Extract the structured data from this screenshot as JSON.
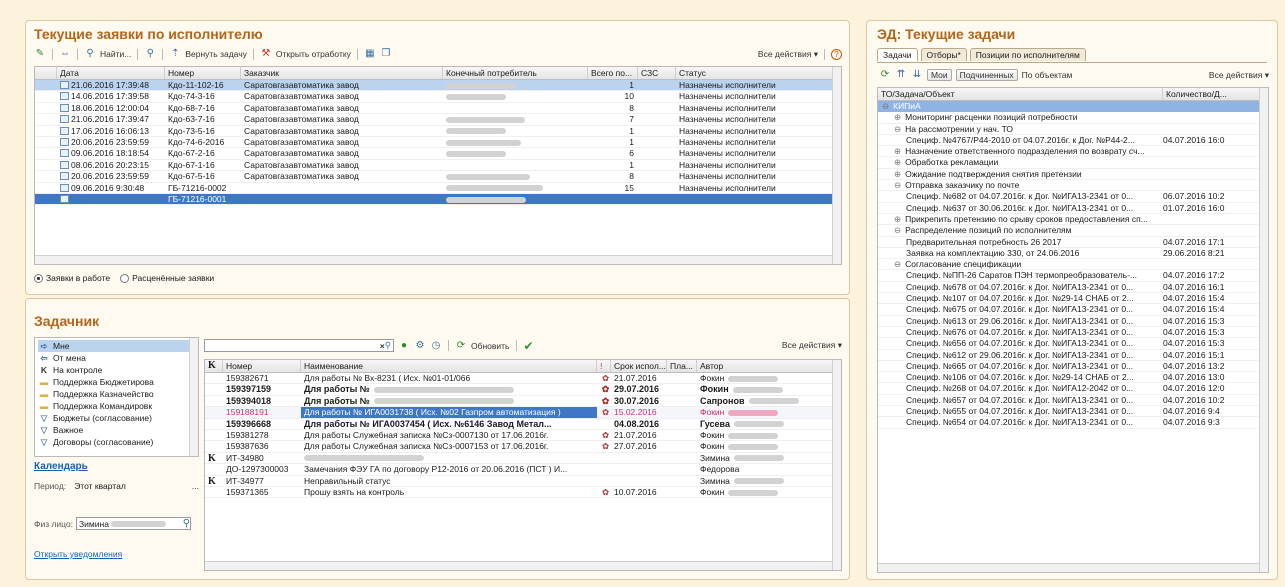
{
  "left_top": {
    "title": "Текущие заявки по исполнителю",
    "toolbar": [
      "Найти...",
      "Вернуть задачу",
      "Открыть отработку"
    ],
    "all_actions": "Все действия ▾",
    "columns": [
      "Дата",
      "Номер",
      "Заказчик",
      "Конечный потребитель",
      "Всего по...",
      "СЗС",
      "Статус"
    ],
    "rows": [
      {
        "date": "21.06.2016 17:39:48",
        "num": "Кдо-11-102-16",
        "cust": "Саратовгазавтоматика завод",
        "total": "1",
        "status": "Назначены исполнители"
      },
      {
        "date": "14.06.2016 17:39:58",
        "num": "Кдо-74-3-16",
        "cust": "Саратовгазавтоматика завод",
        "total": "10",
        "status": "Назначены исполнители"
      },
      {
        "date": "18.06.2016 12:00:04",
        "num": "Кдо-68-7-16",
        "cust": "Саратовгазавтоматика завод",
        "total": "8",
        "status": "Назначены исполнители"
      },
      {
        "date": "21.06.2016 17:39:47",
        "num": "Кдо-63-7-16",
        "cust": "Саратовгазавтоматика завод",
        "total": "7",
        "status": "Назначены исполнители"
      },
      {
        "date": "17.06.2016 16:06:13",
        "num": "Кдо-73-5-16",
        "cust": "Саратовгазавтоматика завод",
        "total": "1",
        "status": "Назначены исполнители"
      },
      {
        "date": "20.06.2016 23:59:59",
        "num": "Кдо-74-6-2016",
        "cust": "Саратовгазавтоматика завод",
        "total": "1",
        "status": "Назначены исполнители"
      },
      {
        "date": "09.06.2016 18:18:54",
        "num": "Кдо-67-2-16",
        "cust": "Саратовгазавтоматика завод",
        "total": "6",
        "status": "Назначены исполнители"
      },
      {
        "date": "08.06.2016 20:23:15",
        "num": "Кдо-67-1-16",
        "cust": "Саратовгазавтоматика завод",
        "total": "1",
        "status": "Назначены исполнители"
      },
      {
        "date": "20.06.2016 23:59:59",
        "num": "Кдо-67-5-16",
        "cust": "Саратовгазавтоматика завод",
        "total": "8",
        "status": "Назначены исполнители"
      },
      {
        "date": "09.06.2016 9:30:48",
        "num": "ГБ-71216-0002",
        "cust": "",
        "total": "15",
        "status": "Назначены исполнители"
      },
      {
        "date": "",
        "num": "ГБ-71216-0001",
        "cust": "",
        "total": "",
        "status": ""
      }
    ],
    "radio_1": "Заявки в работе",
    "radio_2": "Расценённые заявки"
  },
  "left_bottom": {
    "title": "Задачник",
    "list": [
      {
        "label": "Мне",
        "icon": "arrow-right-icon"
      },
      {
        "label": "От мена",
        "icon": "arrow-left-icon"
      },
      {
        "label": "На контроле",
        "icon": "k-icon"
      },
      {
        "label": "Поддержка Бюджетирова",
        "icon": "folder-icon"
      },
      {
        "label": "Поддержка Казначейство",
        "icon": "folder-icon"
      },
      {
        "label": "Поддержка Командировк",
        "icon": "folder-icon"
      },
      {
        "label": "Бюджеты (согласование)",
        "icon": "filter-icon"
      },
      {
        "label": "Важное",
        "icon": "filter-icon"
      },
      {
        "label": "Договоры (согласование)",
        "icon": "filter-icon"
      }
    ],
    "calendar_link": "Календарь",
    "period_label": "Период:",
    "period_value": "Этот квартал",
    "person_label": "Физ лицо:",
    "person_value": "Зимина",
    "notifications_link": "Открыть уведомления",
    "refresh": "Обновить",
    "all_actions": "Все действия ▾",
    "columns": [
      "K",
      "Номер",
      "Наименование",
      "!",
      "Срок испол...",
      "Пла...",
      "Автор"
    ],
    "rows": [
      {
        "k": "",
        "num": "159382671",
        "name": "Для работы № Вх-8231 ( Исх. №01-01/066",
        "flag": "✿",
        "due": "21.07.2016",
        "author": "Фокин",
        "style": ""
      },
      {
        "k": "",
        "num": "159397159",
        "name": "Для работы №",
        "flag": "✿",
        "due": "29.07.2016",
        "author": "Фокин",
        "style": "bold"
      },
      {
        "k": "",
        "num": "159394018",
        "name": "Для работы №",
        "flag": "✿",
        "due": "30.07.2016",
        "author": "Сапронов",
        "style": "bold"
      },
      {
        "k": "",
        "num": "159188191",
        "name": "Для работы № ИГА0031738 ( Исх. №02 Газпром автоматизация )",
        "flag": "✿",
        "due": "15.02.2016",
        "author": "Фокин",
        "style": "sel"
      },
      {
        "k": "",
        "num": "159396668",
        "name": "Для работы № ИГА0037454 ( Исх. №6146 Завод Метал...",
        "flag": "",
        "due": "04.08.2016",
        "author": "Гусева",
        "style": "bold"
      },
      {
        "k": "",
        "num": "159381278",
        "name": "Для работы Служебная записка №Сз-0007130 от 17.06.2016г.",
        "flag": "✿",
        "due": "21.07.2016",
        "author": "Фокин",
        "style": ""
      },
      {
        "k": "",
        "num": "159387636",
        "name": "Для работы Служебная записка №Сз-0007153 от 17.06.2016г.",
        "flag": "✿",
        "due": "27.07.2016",
        "author": "Фокин",
        "style": ""
      },
      {
        "k": "K",
        "num": "ИТ-34980",
        "name": "",
        "flag": "",
        "due": "",
        "author": "Зимина",
        "style": ""
      },
      {
        "k": "",
        "num": "ДО-1297300003",
        "name": "Замечания ФЭУ ГА по договору Р12-2016 от 20.06.2016 (ПСТ ) И...",
        "flag": "",
        "due": "",
        "author": "Федорова",
        "style": ""
      },
      {
        "k": "K",
        "num": "ИТ-34977",
        "name": "Неправильный статус",
        "flag": "",
        "due": "",
        "author": "Зимина",
        "style": ""
      },
      {
        "k": "",
        "num": "159371365",
        "name": "Прошу взять на контроль",
        "flag": "✿",
        "due": "10.07.2016",
        "author": "Фокин",
        "style": ""
      }
    ]
  },
  "right": {
    "title": "ЭД: Текущие задачи",
    "tabs": [
      "Задачи",
      "Отборы*",
      "Позиции по исполнителям"
    ],
    "btn_mine": "Мои",
    "btn_sub": "Подчиненных",
    "by_objects": "По объектам",
    "all_actions": "Все действия ▾",
    "columns": [
      "ТО/Задача/Объект",
      "Количество/Д..."
    ],
    "rows": [
      {
        "t": "КИПиА",
        "d": "",
        "lvl": 0,
        "mark": "⊖",
        "sel": true
      },
      {
        "t": "Мониторинг расценки позиций потребности",
        "d": "",
        "lvl": 1,
        "mark": "⊕"
      },
      {
        "t": "На рассмотрении у нач. ТО",
        "d": "",
        "lvl": 1,
        "mark": "⊖"
      },
      {
        "t": "Специф. №4767/Р44-2010 от 04.07.2016г. к Дог. №Р44-2...",
        "d": "04.07.2016 16:0",
        "lvl": 2,
        "mark": ""
      },
      {
        "t": "Назначение ответственного подразделения по возврату сч...",
        "d": "",
        "lvl": 1,
        "mark": "⊕"
      },
      {
        "t": "Обработка рекламации",
        "d": "",
        "lvl": 1,
        "mark": "⊕"
      },
      {
        "t": "Ожидание подтверждения снятия претензии",
        "d": "",
        "lvl": 1,
        "mark": "⊕"
      },
      {
        "t": "Отправка заказчику по почте",
        "d": "",
        "lvl": 1,
        "mark": "⊖"
      },
      {
        "t": "Специф. №682 от 04.07.2016г. к Дог. №ИГА13-2341 от 0...",
        "d": "06.07.2016 10:2",
        "lvl": 2,
        "mark": ""
      },
      {
        "t": "Специф. №637 от 30.06.2016г. к Дог. №ИГА13-2341 от 0...",
        "d": "01.07.2016 16:0",
        "lvl": 2,
        "mark": ""
      },
      {
        "t": "Прикрепить претензию по срыву сроков предоставления сп...",
        "d": "",
        "lvl": 1,
        "mark": "⊕"
      },
      {
        "t": "Распределение позиций по исполнителям",
        "d": "",
        "lvl": 1,
        "mark": "⊖"
      },
      {
        "t": "Предварительная потребность 26 2017",
        "d": "04.07.2016 17:1",
        "lvl": 2,
        "mark": ""
      },
      {
        "t": "Заявка на комплектацию 330, от 24.06.2016",
        "d": "29.06.2016 8:21",
        "lvl": 2,
        "mark": ""
      },
      {
        "t": "Согласование спецификации",
        "d": "",
        "lvl": 1,
        "mark": "⊖"
      },
      {
        "t": "Специф. №ПП-26 Саратов ПЭН термопреобразователь-...",
        "d": "04.07.2016 17:2",
        "lvl": 2,
        "mark": ""
      },
      {
        "t": "Специф. №678 от 04.07.2016г. к Дог. №ИГА13-2341 от 0...",
        "d": "04.07.2016 16:1",
        "lvl": 2,
        "mark": ""
      },
      {
        "t": "Специф. №107 от 04.07.2016г. к Дог. №29-14 СНАБ от 2...",
        "d": "04.07.2016 15:4",
        "lvl": 2,
        "mark": ""
      },
      {
        "t": "Специф. №675 от 04.07.2016г. к Дог. №ИГА13-2341 от 0...",
        "d": "04.07.2016 15:4",
        "lvl": 2,
        "mark": ""
      },
      {
        "t": "Специф. №613 от 29.06.2016г. к Дог. №ИГА13-2341 от 0...",
        "d": "04.07.2016 15:3",
        "lvl": 2,
        "mark": ""
      },
      {
        "t": "Специф. №676 от 04.07.2016г. к Дог. №ИГА13-2341 от 0...",
        "d": "04.07.2016 15:3",
        "lvl": 2,
        "mark": ""
      },
      {
        "t": "Специф. №656 от 04.07.2016г. к Дог. №ИГА13-2341 от 0...",
        "d": "04.07.2016 15:3",
        "lvl": 2,
        "mark": ""
      },
      {
        "t": "Специф. №612 от 29.06.2016г. к Дог. №ИГА13-2341 от 0...",
        "d": "04.07.2016 15:1",
        "lvl": 2,
        "mark": ""
      },
      {
        "t": "Специф. №665 от 04.07.2016г. к Дог. №ИГА13-2341 от 0...",
        "d": "04.07.2016 13:2",
        "lvl": 2,
        "mark": ""
      },
      {
        "t": "Специф. №106 от 04.07.2016г. к Дог. №29-14 СНАБ от 2...",
        "d": "04.07.2016 13:0",
        "lvl": 2,
        "mark": ""
      },
      {
        "t": "Специф. №268 от 04.07.2016г. к Дог. №ИГА12-2042 от 0...",
        "d": "04.07.2016 12:0",
        "lvl": 2,
        "mark": ""
      },
      {
        "t": "Специф. №657 от 04.07.2016г. к Дог. №ИГА13-2341 от 0...",
        "d": "04.07.2016 10:2",
        "lvl": 2,
        "mark": ""
      },
      {
        "t": "Специф. №655 от 04.07.2016г. к Дог. №ИГА13-2341 от 0...",
        "d": "04.07.2016 9:4",
        "lvl": 2,
        "mark": ""
      },
      {
        "t": "Специф. №654 от 04.07.2016г. к Дог. №ИГА13-2341 от 0...",
        "d": "04.07.2016 9:3",
        "lvl": 2,
        "mark": ""
      }
    ]
  }
}
